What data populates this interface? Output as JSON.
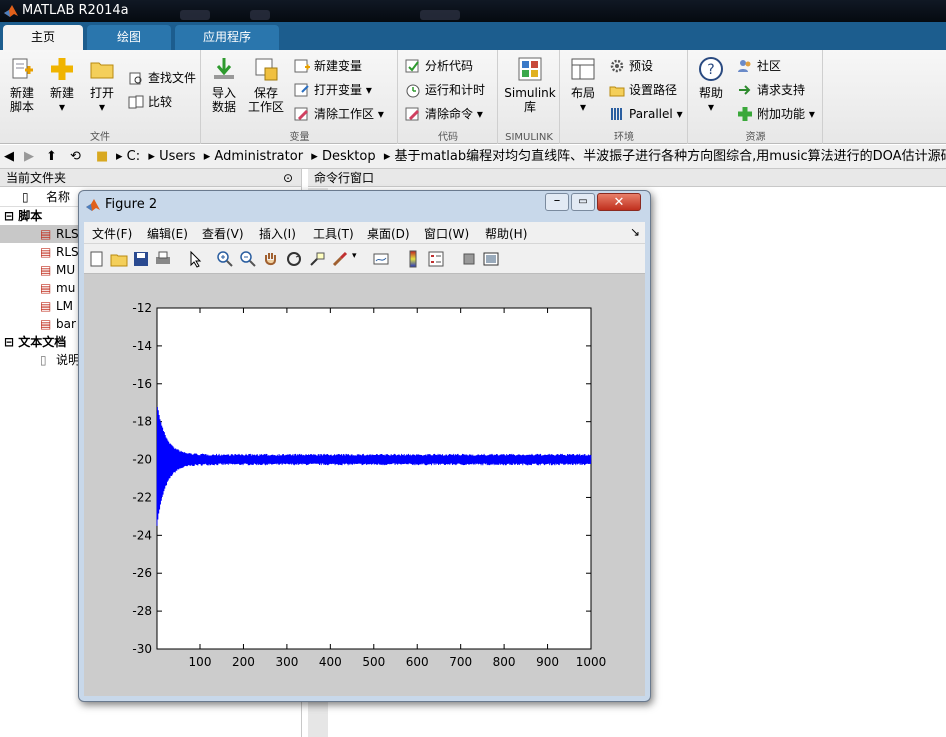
{
  "app": {
    "title": "MATLAB R2014a"
  },
  "tabs": [
    {
      "label": "主页",
      "active": true
    },
    {
      "label": "绘图",
      "active": false
    },
    {
      "label": "应用程序",
      "active": false
    }
  ],
  "ribbon": {
    "file": {
      "section_label": "文件",
      "new_script": [
        "新建",
        "脚本"
      ],
      "new": "新建",
      "open": "打开",
      "find_files": "查找文件",
      "compare": "比较"
    },
    "variable": {
      "section_label": "变量",
      "import": [
        "导入",
        "数据"
      ],
      "save_ws": [
        "保存",
        "工作区"
      ],
      "new_var": "新建变量",
      "open_var": "打开变量",
      "clear_ws": "清除工作区"
    },
    "code": {
      "section_label": "代码",
      "analyze": "分析代码",
      "run_time": "运行和计时",
      "clear_cmd": "清除命令"
    },
    "simulink": {
      "section_label": "SIMULINK",
      "lib": [
        "Simulink",
        "库"
      ]
    },
    "env": {
      "section_label": "环境",
      "layout": "布局",
      "prefs": "预设",
      "set_path": "设置路径",
      "parallel": "Parallel"
    },
    "resources": {
      "section_label": "资源",
      "help": "帮助",
      "community": "社区",
      "support": "请求支持",
      "addons": "附加功能"
    }
  },
  "address": {
    "path": [
      "C:",
      "Users",
      "Administrator",
      "Desktop",
      "基于matlab编程对均匀直线阵、半波振子进行各种方向图综合,用music算法进行的DOA估计源码程序"
    ]
  },
  "current_folder": {
    "title": "当前文件夹",
    "column": "名称",
    "groups": [
      {
        "label": "脚本",
        "items": [
          "RLS",
          "RLS",
          "MU",
          "mu",
          "LM",
          "bar"
        ]
      },
      {
        "label": "文本文档",
        "items": [
          "说明"
        ]
      }
    ]
  },
  "command_window": {
    "title": "命令行窗口"
  },
  "figure": {
    "title": "Figure 2",
    "menu": [
      "文件(F)",
      "编辑(E)",
      "查看(V)",
      "插入(I)",
      "工具(T)",
      "桌面(D)",
      "窗口(W)",
      "帮助(H)"
    ]
  },
  "colors": {
    "plot_line": "#0000ff",
    "tab_bar": "#1c5d8e"
  },
  "chart_data": {
    "type": "line",
    "title": "",
    "xlabel": "",
    "ylabel": "",
    "xlim": [
      1,
      1000
    ],
    "ylim": [
      -30,
      -12
    ],
    "xticks": [
      100,
      200,
      300,
      400,
      500,
      600,
      700,
      800,
      900,
      1000
    ],
    "yticks": [
      -12,
      -14,
      -16,
      -18,
      -20,
      -22,
      -24,
      -26,
      -28,
      -30
    ],
    "series": [
      {
        "color": "#0000ff",
        "initial_value": -17,
        "initial_low": -23.5,
        "steady_state": -20,
        "steady_band": [
          -20.3,
          -19.7
        ],
        "settle_x": 20
      }
    ]
  }
}
